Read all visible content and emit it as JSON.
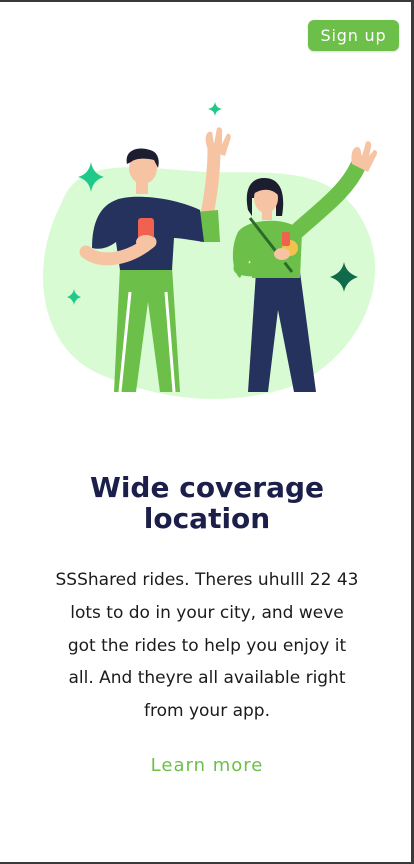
{
  "header": {
    "signup_label": "Sign up"
  },
  "illustration": {
    "icons": [
      "sparkle-icon",
      "man-waving-figure",
      "woman-waving-figure",
      "phone-icon",
      "medal-icon"
    ]
  },
  "hero": {
    "title_line1": "Wide coverage",
    "title_line2": "location",
    "description_lines": [
      "SSShared rides. Theres uhulll 22 43",
      "lots to do in your city, and weve",
      "got the rides to help you enjoy it",
      "all. And theyre all available right",
      "from your app."
    ],
    "learn_more_label": "Learn more"
  },
  "colors": {
    "accent": "#6cc04a",
    "title": "#1d1f4b",
    "blob": "#d9fbd3",
    "sparkle": "#1fc98a",
    "navy": "#25325e"
  }
}
